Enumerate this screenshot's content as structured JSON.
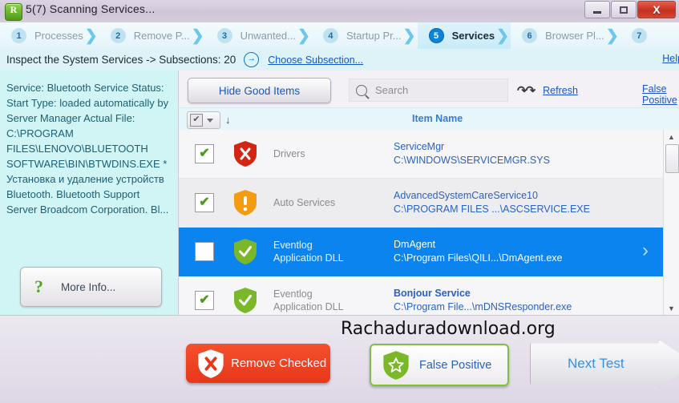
{
  "window": {
    "logo_letter": "R",
    "title": "5(7) Scanning Services...",
    "controls": {
      "minimize": "minimize-button",
      "maximize": "maximize-button",
      "close": "X"
    }
  },
  "wizard": {
    "steps": [
      {
        "num": "1",
        "label": "Processes",
        "active": false
      },
      {
        "num": "2",
        "label": "Remove P...",
        "active": false
      },
      {
        "num": "3",
        "label": "Unwanted...",
        "active": false
      },
      {
        "num": "4",
        "label": "Startup Pr...",
        "active": false
      },
      {
        "num": "5",
        "label": "Services",
        "active": true
      },
      {
        "num": "6",
        "label": "Browser Pl...",
        "active": false
      },
      {
        "num": "7",
        "label": "",
        "active": false
      }
    ]
  },
  "subheader": {
    "text": "Inspect the System Services -> Subsections: 20",
    "arrow_glyph": "→",
    "choose_link": "Choose Subsection...",
    "help_link": "Help"
  },
  "left_panel": {
    "description": "Service: Bluetooth Service Status: Start Type: loaded automatically by Server Manager Actual File: C:\\PROGRAM FILES\\LENOVO\\BLUETOOTH SOFTWARE\\BIN\\BTWDINS.EXE * Установка и удаление устройств Bluetooth. Bluetooth Support Server Broadcom Corporation. Bl...",
    "more_info_label": "More Info...",
    "more_info_icon": "?"
  },
  "toolbar": {
    "hide_good_items": "Hide Good Items",
    "search_placeholder": "Search",
    "search_value": "",
    "refresh_label": "Refresh",
    "false_positive_link": "False Positive"
  },
  "list_header": {
    "select_all_checked": "✔",
    "dropdown": "chevron-down-icon",
    "sort_arrow": "↓",
    "column_item_name": "Item Name"
  },
  "rows": [
    {
      "checked": true,
      "severity": "red",
      "severity_glyph": "✕",
      "category_line1": "Drivers",
      "category_line2": "",
      "name": "ServiceMgr",
      "name_bold": false,
      "path": "C:\\WINDOWS\\SERVICEMGR.SYS",
      "selected": false
    },
    {
      "checked": true,
      "severity": "orange",
      "severity_glyph": "!",
      "category_line1": "Auto Services",
      "category_line2": "",
      "name": "AdvancedSystemCareService10",
      "name_bold": false,
      "path": "C:\\PROGRAM FILES ...\\ASCSERVICE.EXE",
      "selected": false
    },
    {
      "checked": false,
      "severity": "green",
      "severity_glyph": "✓",
      "category_line1": "Eventlog",
      "category_line2": "Application DLL",
      "name": "DmAgent",
      "name_bold": false,
      "path": "C:\\Program Files\\QILI...\\DmAgent.exe",
      "selected": true,
      "chevron": "›"
    },
    {
      "checked": true,
      "severity": "green",
      "severity_glyph": "✓",
      "category_line1": "Eventlog",
      "category_line2": "Application DLL",
      "name": "Bonjour Service",
      "name_bold": true,
      "path": "C:\\Program File...\\mDNSResponder.exe",
      "selected": false
    }
  ],
  "scrollbar": {
    "up": "▲",
    "down": "▼"
  },
  "footer": {
    "watermark": "Rachaduradownload.org",
    "remove_checked": "Remove Checked",
    "false_positive": "False Positive",
    "next_test": "Next Test"
  },
  "colors": {
    "accent_blue": "#0c84ef",
    "danger_red": "#e8371a",
    "ok_green": "#7fc13b",
    "warn_orange": "#f39c12",
    "link_blue": "#1657c8"
  }
}
